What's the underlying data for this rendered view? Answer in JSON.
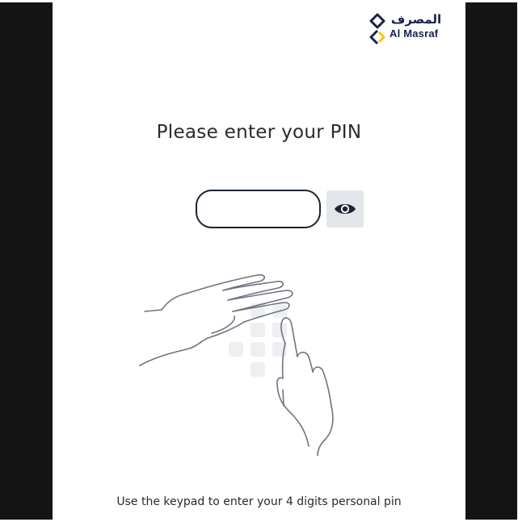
{
  "brand": {
    "name_ar": "المصرف",
    "name_en": "Al Masraf",
    "colors": {
      "navy": "#17214a",
      "accent_yellow": "#f5c400"
    }
  },
  "pin_screen": {
    "title": "Please enter your PIN",
    "pin_input": {
      "value": "",
      "placeholder": ""
    },
    "toggle_visibility_icon": "eye-icon",
    "illustration_icon": "hands-keypad-illustration",
    "hint": "Use the keypad to enter your 4 digits personal pin"
  }
}
